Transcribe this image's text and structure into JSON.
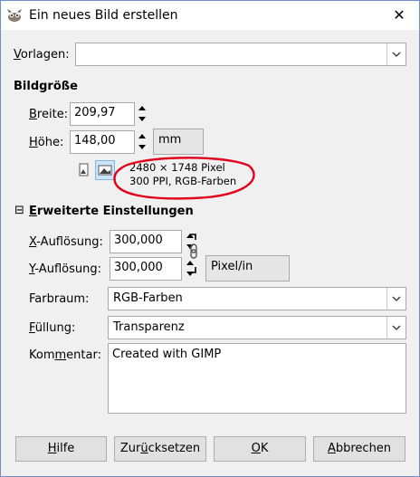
{
  "window": {
    "title": "Ein neues Bild erstellen",
    "close_glyph": "✕"
  },
  "templates": {
    "label_first": "V",
    "label_rest": "orlagen:",
    "value": ""
  },
  "image_size": {
    "heading": "Bildgröße",
    "width_label_first": "B",
    "width_label_rest": "reite:",
    "width_value": "209,97",
    "height_label_first": "H",
    "height_label_rest": "öhe:",
    "height_value": "148,00",
    "unit": "mm",
    "info_line1": "2480 × 1748 Pixel",
    "info_line2": "300 PPI, RGB-Farben"
  },
  "advanced": {
    "expander": "⊟",
    "heading_first": "E",
    "heading_rest": "rweiterte Einstellungen",
    "xres_label_first": "X",
    "xres_label_rest": "-Auflösung:",
    "xres_value": "300,000",
    "yres_label_first": "Y",
    "yres_label_rest": "-Auflösung:",
    "yres_value": "300,000",
    "res_unit": "Pixel/in",
    "colorspace_label": "Farbraum:",
    "colorspace_value": "RGB-Farben",
    "fill_label_first": "F",
    "fill_label_rest": "üllung:",
    "fill_value": "Transparenz",
    "comment_label_pre": "Kom",
    "comment_label_u": "m",
    "comment_label_post": "entar:",
    "comment_value": "Created with GIMP"
  },
  "buttons": {
    "help_first": "H",
    "help_rest": "ilfe",
    "reset_first": "Zur",
    "reset_u": "ü",
    "reset_rest": "cksetzen",
    "ok_first": "O",
    "ok_rest": "K",
    "cancel_first": "A",
    "cancel_rest": "bbrechen"
  },
  "annotation_color": "#e0001b"
}
